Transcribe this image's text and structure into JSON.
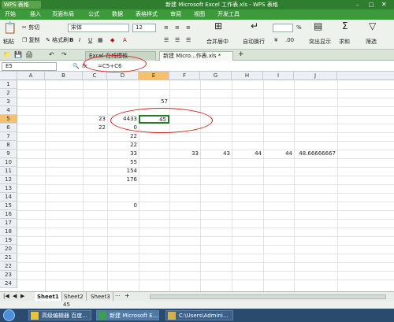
{
  "app": {
    "button_label": "WPS 表格",
    "window_title": "新建 Microsoft Excel 工作表.xls - WPS 表格"
  },
  "menu": {
    "items": [
      "开始",
      "插入",
      "页面布局",
      "公式",
      "数据",
      "表格样式",
      "审阅",
      "视图",
      "开发工具"
    ]
  },
  "toolbar": {
    "cut": "剪切",
    "paste": "粘贴",
    "copy": "复制",
    "format_painter": "格式刷",
    "font_name": "宋体",
    "font_size": "12",
    "merge_center": "合并居中",
    "wrap_text": "自动换行",
    "percent": "%",
    "highlight": "突出显示",
    "sum": "求和",
    "filter": "筛选"
  },
  "tabs": {
    "items": [
      "Excel-在线模板",
      "新建 Micro...作表.xls *"
    ],
    "add": "+"
  },
  "formula_bar": {
    "name_box": "E5",
    "fx": "fx",
    "formula": "=C5+C6"
  },
  "columns": [
    "A",
    "B",
    "C",
    "D",
    "E",
    "F",
    "G",
    "H",
    "I",
    "J"
  ],
  "rows": [
    "1",
    "2",
    "3",
    "4",
    "5",
    "6",
    "7",
    "8",
    "9",
    "10",
    "11",
    "12",
    "13",
    "14",
    "15",
    "16",
    "17",
    "18",
    "19",
    "20",
    "21",
    "22",
    "23",
    "24"
  ],
  "cells": {
    "E3": "57",
    "C5": "23",
    "D5": "4433",
    "E5": "45",
    "C6": "22",
    "D6": "0",
    "D7": "22",
    "D8": "22",
    "D9": "33",
    "F9": "33",
    "G9": "43",
    "H9": "44",
    "I9": "44",
    "J9": "48.66666667",
    "D10": "55",
    "D11": "154",
    "D12": "176",
    "D15": "0"
  },
  "sheets": {
    "items": [
      "Sheet1",
      "Sheet2",
      "Sheet3"
    ],
    "more": "+"
  },
  "status": {
    "value": "45"
  },
  "taskbar": {
    "items": [
      "高级编辑器 百度...",
      "新建 Microsoft E...",
      "C:\\Users\\Admini..."
    ]
  },
  "colors": {
    "accent": "#3d9a3a",
    "annotation": "#d42020"
  }
}
